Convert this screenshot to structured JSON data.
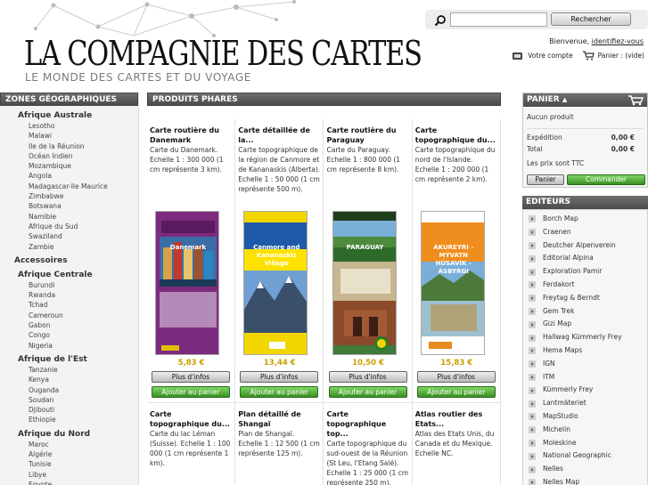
{
  "header": {
    "logo_title": "LA COMPAGNIE DES CARTES",
    "logo_subtitle": "LE MONDE DES CARTES ET DU VOYAGE",
    "search": {
      "value": "",
      "button_label": "Rechercher"
    },
    "welcome_text": "Bienvenue,",
    "login_link": "identifiez-vous",
    "account_label": "Votre compte",
    "cart_label": "Panier : (vide)"
  },
  "sidebar": {
    "title": "ZONES GÉOGRAPHIQUES",
    "regions": [
      {
        "name": "Afrique Australe",
        "countries": [
          "Lesotho",
          "Malawi",
          "Ile de la Réunion",
          "Océan Indien",
          "Mozambique",
          "Angola",
          "Madagascar-Ile Maurice",
          "Zimbabwe",
          "Botswana",
          "Namibie",
          "Afrique du Sud",
          "Swaziland",
          "Zambie"
        ]
      },
      {
        "name": "Accessoires",
        "countries": []
      },
      {
        "name": "Afrique Centrale",
        "countries": [
          "Burundi",
          "Rwanda",
          "Tchad",
          "Cameroun",
          "Gabon",
          "Congo",
          "Nigeria"
        ]
      },
      {
        "name": "Afrique de l'Est",
        "countries": [
          "Tanzanie",
          "Kenya",
          "Ouganda",
          "Soudan",
          "Djibouti",
          "Ethiopie"
        ]
      },
      {
        "name": "Afrique du Nord",
        "countries": [
          "Maroc",
          "Algérie",
          "Tunisie",
          "Libye",
          "Egypte"
        ]
      }
    ]
  },
  "products": {
    "title": "PRODUITS PHARES",
    "more_label": "Plus d'infos",
    "add_label": "Ajouter au panier",
    "row1": [
      {
        "title": "Carte routière du Danemark",
        "desc": "Carte du Danemark. Echelle 1 : 300 000 (1 cm représente 3 km).",
        "price": "5,83 €",
        "cover": "Danemark"
      },
      {
        "title": "Carte détaillée de la...",
        "desc": "Carte topographique de la région de Canmore et de Kananaskis (Alberta). Echelle 1 : 50 000 (1 cm représente 500 m).",
        "price": "13,44 €",
        "cover": "Canmore and Kananaskis Village"
      },
      {
        "title": "Carte routière du Paraguay",
        "desc": "Carte du Paraguay. Echelle 1 : 800 000 (1 cm représente 8 km).",
        "price": "10,50 €",
        "cover": "PARAGUAY"
      },
      {
        "title": "Carte topographique du...",
        "desc": "Carte topographique du nord de l'Islande. Echelle 1 : 200 000 (1 cm représente 2 km).",
        "price": "15,83 €",
        "cover": "AKUREYRI - MÝVATN HÚSAVÍK - ÁSBYRGI"
      }
    ],
    "row2": [
      {
        "title": "Carte topographique du...",
        "desc": "Carte du lac Léman (Suisse). Echelle 1 : 100 000 (1 cm représente 1 km)."
      },
      {
        "title": "Plan détaillé de Shangaï",
        "desc": "Plan de Shangaï. Echelle 1 : 12 500 (1 cm représente 125 m)."
      },
      {
        "title": "Carte topographique top...",
        "desc": "Carte topographique du sud-ouest de la Réunion (St Leu, l'Etang Salé). Echelle 1 : 25 000 (1 cm représente 250 m)."
      },
      {
        "title": "Atlas routier des Etats...",
        "desc": "Atlas des Etats Unis, du Canada et du Mexique. Echelle NC."
      }
    ]
  },
  "cart": {
    "title": "PANIER",
    "no_product": "Aucun produit",
    "shipping_label": "Expédition",
    "shipping_value": "0,00 €",
    "total_label": "Total",
    "total_value": "0,00 €",
    "tax_note": "Les prix sont TTC",
    "cart_button": "Panier",
    "order_button": "Commander"
  },
  "publishers": {
    "title": "EDITEURS",
    "items": [
      "Borch Map",
      "Craenen",
      "Deutcher Alpenverein",
      "Editorial Alpina",
      "Exploration Pamir",
      "Ferdakort",
      "Freytag & Berndt",
      "Gem Trek",
      "Gizi Map",
      "Hallwag Kümmerly Frey",
      "Hema Maps",
      "IGN",
      "ITM",
      "Kümmerly Frey",
      "Lantmäteriet",
      "MapStudio",
      "Michelin",
      "Moleskine",
      "National Geographic",
      "Nelles",
      "Nelles Map"
    ]
  },
  "colors": {
    "accent_green": "#3a8f24",
    "price_gold": "#c9a000",
    "header_dark": "#555555"
  }
}
